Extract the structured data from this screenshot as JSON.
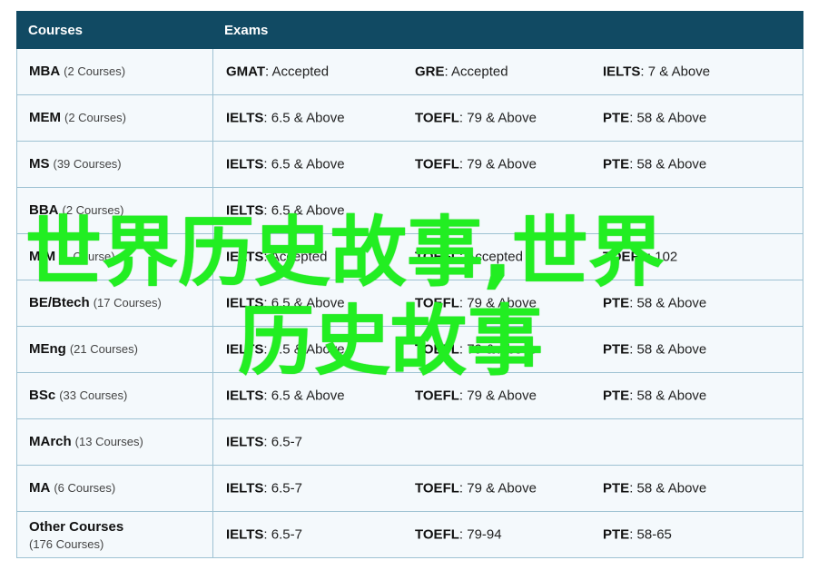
{
  "table": {
    "headers": {
      "courses": "Courses",
      "exams": "Exams"
    },
    "rows": [
      {
        "course": "MBA",
        "count": "(2 Courses)",
        "exams": [
          {
            "name": "GMAT",
            "req": ": Accepted"
          },
          {
            "name": "GRE",
            "req": ": Accepted"
          },
          {
            "name": "IELTS",
            "req": ": 7 & Above"
          }
        ]
      },
      {
        "course": "MEM",
        "count": "(2 Courses)",
        "exams": [
          {
            "name": "IELTS",
            "req": ": 6.5 & Above"
          },
          {
            "name": "TOEFL",
            "req": ": 79 & Above"
          },
          {
            "name": "PTE",
            "req": ": 58 & Above"
          }
        ]
      },
      {
        "course": "MS",
        "count": "(39 Courses)",
        "exams": [
          {
            "name": "IELTS",
            "req": ": 6.5 & Above"
          },
          {
            "name": "TOEFL",
            "req": ": 79 & Above"
          },
          {
            "name": "PTE",
            "req": ": 58 & Above"
          }
        ]
      },
      {
        "course": "BBA",
        "count": "(2 Courses)",
        "exams": [
          {
            "name": "IELTS",
            "req": ": 6.5 & Above"
          },
          {
            "name": "",
            "req": ""
          },
          {
            "name": "",
            "req": ""
          }
        ]
      },
      {
        "course": "MIM",
        "count": "(1 Course)",
        "exams": [
          {
            "name": "IELTS",
            "req": ": Accepted"
          },
          {
            "name": "TOEFL",
            "req": ": Accepted"
          },
          {
            "name": "TOEFL",
            "req": ": 102"
          }
        ]
      },
      {
        "course": "BE/Btech",
        "count": "(17 Courses)",
        "exams": [
          {
            "name": "IELTS",
            "req": ": 6.5 & Above"
          },
          {
            "name": "TOEFL",
            "req": ": 79 & Above"
          },
          {
            "name": "PTE",
            "req": ": 58 & Above"
          }
        ]
      },
      {
        "course": "MEng",
        "count": "(21 Courses)",
        "exams": [
          {
            "name": "IELTS",
            "req": ": 6.5 & Above"
          },
          {
            "name": "TOEFL",
            "req": ": 79 & Above"
          },
          {
            "name": "PTE",
            "req": ": 58 & Above"
          }
        ]
      },
      {
        "course": "BSc",
        "count": "(33 Courses)",
        "exams": [
          {
            "name": "IELTS",
            "req": ": 6.5 & Above"
          },
          {
            "name": "TOEFL",
            "req": ": 79 & Above"
          },
          {
            "name": "PTE",
            "req": ": 58 & Above"
          }
        ]
      },
      {
        "course": "MArch",
        "count": "(13 Courses)",
        "exams": [
          {
            "name": "IELTS",
            "req": ": 6.5-7"
          },
          {
            "name": "",
            "req": ""
          },
          {
            "name": "",
            "req": ""
          }
        ]
      },
      {
        "course": "MA",
        "count": "(6 Courses)",
        "exams": [
          {
            "name": "IELTS",
            "req": ": 6.5-7"
          },
          {
            "name": "TOEFL",
            "req": ": 79 & Above"
          },
          {
            "name": "PTE",
            "req": ": 58 & Above"
          }
        ]
      },
      {
        "course": "Other Courses",
        "count": "(176 Courses)",
        "exams": [
          {
            "name": "IELTS",
            "req": ": 6.5-7"
          },
          {
            "name": "TOEFL",
            "req": ": 79-94"
          },
          {
            "name": "PTE",
            "req": ": 58-65"
          }
        ]
      }
    ]
  },
  "overlay": {
    "line1": "世界历史故事,世界",
    "line2": "历史故事",
    "color": "#22ee22"
  },
  "colors": {
    "header_bg": "#114a63",
    "row_bg": "#f4f9fc",
    "border": "#9ec2d3"
  }
}
